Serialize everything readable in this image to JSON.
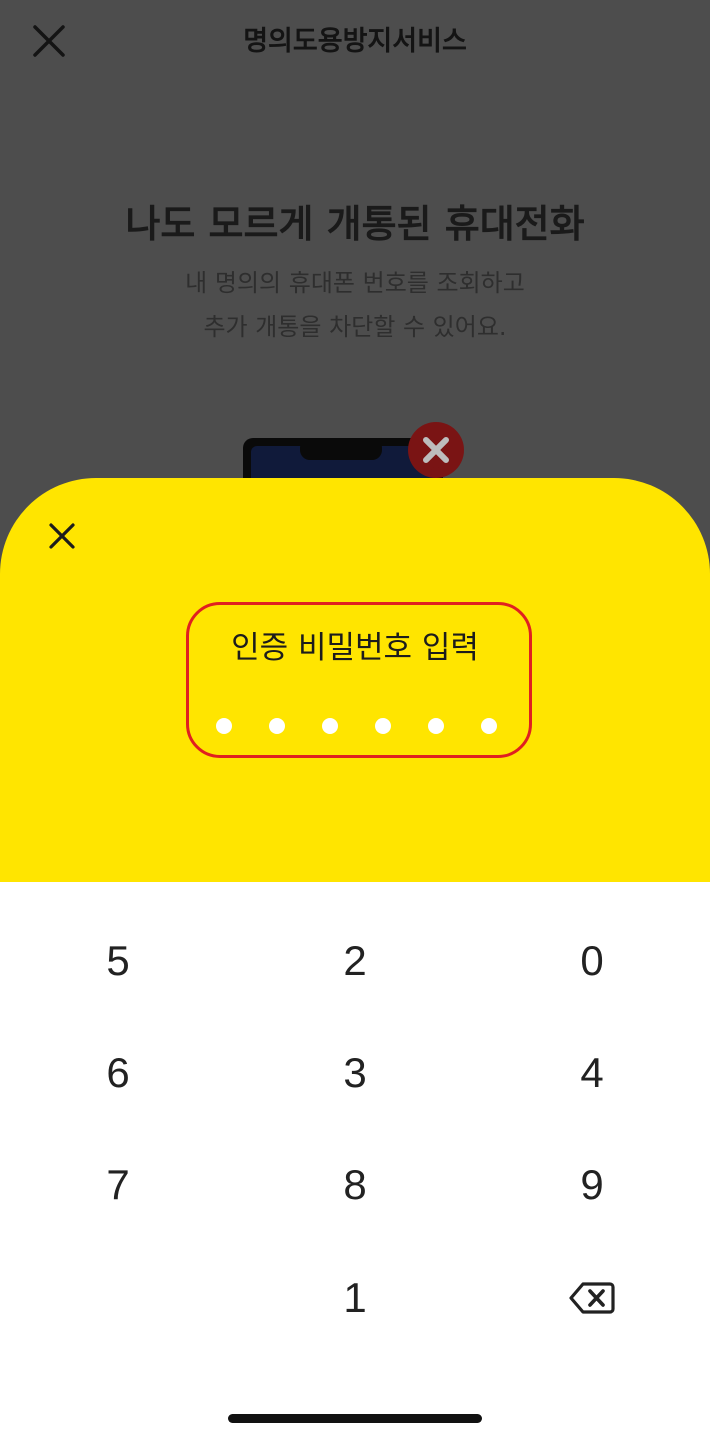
{
  "background_page": {
    "title": "명의도용방지서비스",
    "headline": "나도 모르게 개통된 휴대전화",
    "description_line1": "내 명의의 휴대폰 번호를 조회하고",
    "description_line2": "추가 개통을 차단할 수 있어요."
  },
  "pin_sheet": {
    "title": "인증 비밀번호 입력",
    "pin_length": 6,
    "entered_digits": 0
  },
  "keypad": {
    "rows": [
      [
        "5",
        "2",
        "0"
      ],
      [
        "6",
        "3",
        "4"
      ],
      [
        "7",
        "8",
        "9"
      ],
      [
        "",
        "1",
        "⌫"
      ]
    ]
  },
  "colors": {
    "overlay_background": "#4d4d4d",
    "sheet_yellow": "#ffe500",
    "highlight_border": "#e02020",
    "keypad_background": "#ffffff"
  }
}
